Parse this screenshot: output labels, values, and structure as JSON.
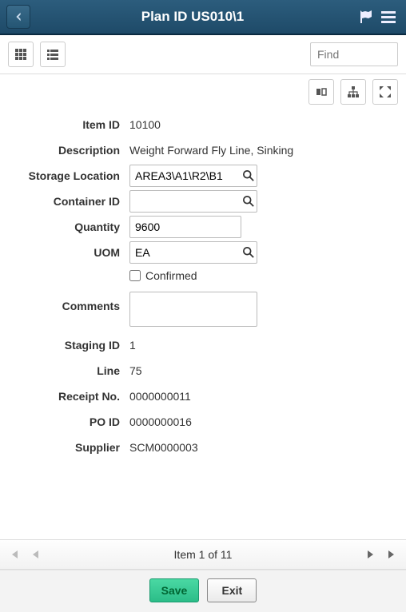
{
  "header": {
    "title": "Plan ID US010\\1"
  },
  "subbar": {
    "find_placeholder": "Find"
  },
  "form": {
    "item_id_label": "Item ID",
    "item_id": "10100",
    "description_label": "Description",
    "description": "Weight Forward Fly Line, Sinking",
    "storage_label": "Storage Location",
    "storage": "AREA3\\A1\\R2\\B1",
    "container_label": "Container ID",
    "container": "",
    "quantity_label": "Quantity",
    "quantity": "9600",
    "uom_label": "UOM",
    "uom": "EA",
    "confirmed_label": "Confirmed",
    "comments_label": "Comments",
    "comments": "",
    "staging_label": "Staging ID",
    "staging": "1",
    "line_label": "Line",
    "line": "75",
    "receipt_label": "Receipt No.",
    "receipt": "0000000011",
    "po_label": "PO ID",
    "po": "0000000016",
    "supplier_label": "Supplier",
    "supplier": "SCM0000003"
  },
  "pager": {
    "text": "Item 1 of 11"
  },
  "footer": {
    "save": "Save",
    "exit": "Exit"
  }
}
